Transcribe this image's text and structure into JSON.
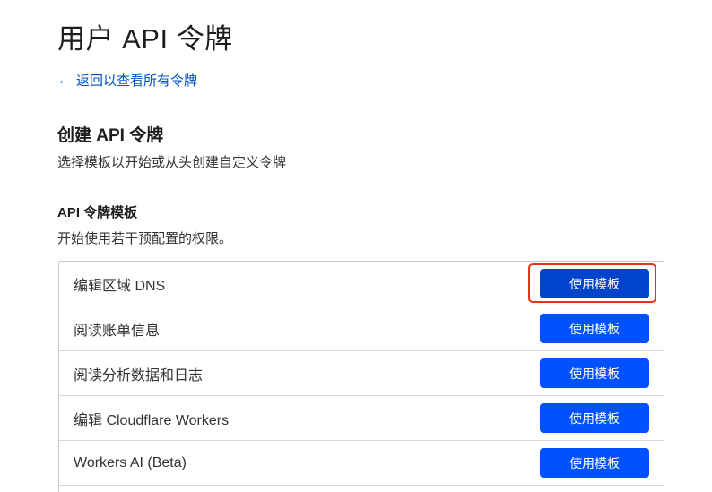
{
  "page": {
    "title": "用户 API 令牌",
    "back_link": "返回以查看所有令牌",
    "back_arrow": "←"
  },
  "create_section": {
    "title": "创建 API 令牌",
    "description": "选择模板以开始或从头创建自定义令牌"
  },
  "templates_section": {
    "title": "API 令牌模板",
    "description": "开始使用若干预配置的权限。"
  },
  "templates": [
    {
      "name": "编辑区域 DNS",
      "button": "使用模板",
      "highlighted": true
    },
    {
      "name": "阅读账单信息",
      "button": "使用模板",
      "highlighted": false
    },
    {
      "name": "阅读分析数据和日志",
      "button": "使用模板",
      "highlighted": false
    },
    {
      "name": "编辑 Cloudflare Workers",
      "button": "使用模板",
      "highlighted": false
    },
    {
      "name": "Workers AI (Beta)",
      "button": "使用模板",
      "highlighted": false
    }
  ],
  "colors": {
    "link": "#0051c3",
    "button": "#0051ff",
    "button_highlighted": "#0044cc",
    "highlight_border": "#e8321c"
  }
}
